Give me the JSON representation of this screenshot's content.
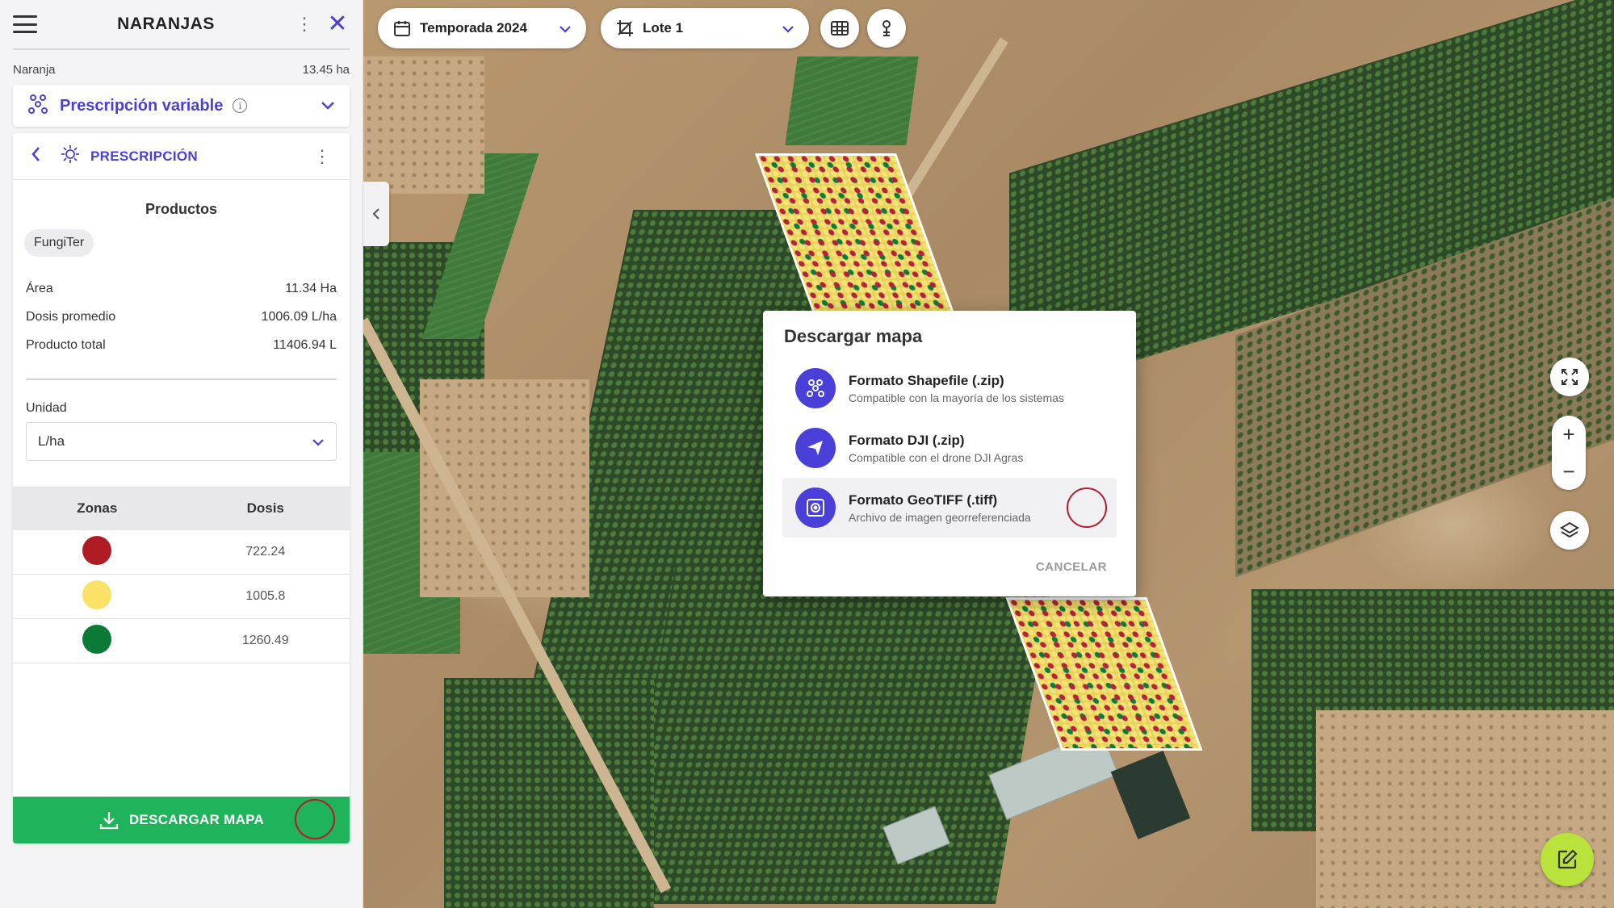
{
  "panel": {
    "title": "NARANJAS",
    "crop_name": "Naranja",
    "crop_area": "13.45 ha",
    "mode_label": "Prescripción variable",
    "section_label": "PRESCRIPCIÓN",
    "products_title": "Productos",
    "product_chip": "FungiTer",
    "stats": [
      {
        "label": "Área",
        "value": "11.34 Ha"
      },
      {
        "label": "Dosis promedio",
        "value": "1006.09 L/ha"
      },
      {
        "label": "Producto total",
        "value": "11406.94 L"
      }
    ],
    "unit_label": "Unidad",
    "unit_value": "L/ha",
    "zones_header": {
      "zone": "Zonas",
      "dose": "Dosis"
    },
    "zones": [
      {
        "color": "#b01c24",
        "dose": "722.24"
      },
      {
        "color": "#fbe165",
        "dose": "1005.8"
      },
      {
        "color": "#0a7a36",
        "dose": "1260.49"
      }
    ],
    "download_label": "DESCARGAR MAPA"
  },
  "toolbar": {
    "season": "Temporada 2024",
    "lot": "Lote 1"
  },
  "dialog": {
    "title": "Descargar mapa",
    "options": [
      {
        "title": "Formato Shapefile (.zip)",
        "subtitle": "Compatible con la mayoría de los sistemas",
        "icon": "shapefile-icon"
      },
      {
        "title": "Formato DJI (.zip)",
        "subtitle": "Compatible con el drone DJI Agras",
        "icon": "drone-icon"
      },
      {
        "title": "Formato GeoTIFF (.tiff)",
        "subtitle": "Archivo de imagen georreferenciada",
        "icon": "geotiff-icon"
      }
    ],
    "cancel": "CANCELAR"
  },
  "colors": {
    "accent": "#4a3fd9",
    "download": "#1fb35c",
    "fab": "#b9e23a",
    "highlight_ring": "#b31c2b"
  }
}
